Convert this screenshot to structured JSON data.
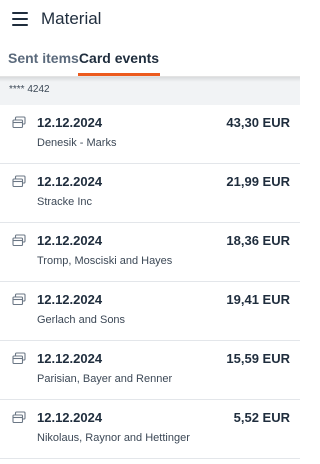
{
  "app_bar": {
    "title": "Material",
    "menu_icon": "hamburger-menu-icon"
  },
  "tabs": [
    {
      "label": "Sent items",
      "active": false
    },
    {
      "label": "Card events",
      "active": true
    }
  ],
  "colors": {
    "accent": "#ec5a1d",
    "text": "#1f2d3d",
    "subtle_bg": "#f1f3f5"
  },
  "card": {
    "masked_number": "**** 4242"
  },
  "events": [
    {
      "date": "12.12.2024",
      "amount": "43,30 EUR",
      "merchant": "Denesik - Marks",
      "icon": "card-payment-icon"
    },
    {
      "date": "12.12.2024",
      "amount": "21,99 EUR",
      "merchant": "Stracke Inc",
      "icon": "card-payment-icon"
    },
    {
      "date": "12.12.2024",
      "amount": "18,36 EUR",
      "merchant": "Tromp, Mosciski and Hayes",
      "icon": "card-payment-icon"
    },
    {
      "date": "12.12.2024",
      "amount": "19,41 EUR",
      "merchant": "Gerlach and Sons",
      "icon": "card-payment-icon"
    },
    {
      "date": "12.12.2024",
      "amount": "15,59 EUR",
      "merchant": "Parisian, Bayer and Renner",
      "icon": "card-payment-icon"
    },
    {
      "date": "12.12.2024",
      "amount": "5,52 EUR",
      "merchant": "Nikolaus, Raynor and Hettinger",
      "icon": "card-payment-icon"
    }
  ]
}
